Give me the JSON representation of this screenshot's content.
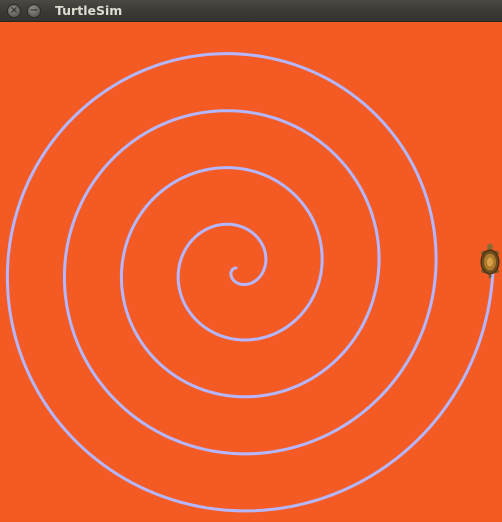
{
  "window": {
    "title": "TurtleSim",
    "close_glyph": "×",
    "minimize_glyph": "−"
  },
  "canvas": {
    "background_color": "#f45b24",
    "pen_color": "#b4b6ff"
  },
  "icons": {
    "close": "close-icon",
    "minimize": "minimize-icon",
    "turtle": "turtle-icon"
  }
}
